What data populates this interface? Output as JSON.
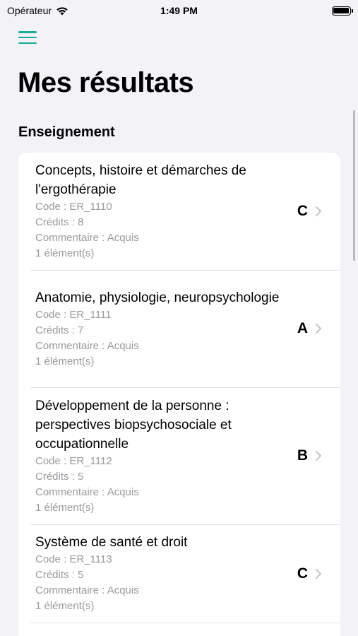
{
  "status_bar": {
    "carrier": "Opérateur",
    "time": "1:49 PM"
  },
  "header": {
    "title": "Mes résultats"
  },
  "section": {
    "title": "Enseignement"
  },
  "courses": [
    {
      "title": "Concepts, histoire et démarches de l'ergothérapie",
      "code": "Code : ER_1110",
      "credits": "Crédits : 8",
      "comment": "Commentaire : Acquis",
      "elements": "1 élément(s)",
      "grade": "C"
    },
    {
      "title": "Anatomie, physiologie, neuropsychologie",
      "code": "Code : ER_1111",
      "credits": "Crédits : 7",
      "comment": "Commentaire : Acquis",
      "elements": "1 élément(s)",
      "grade": "A"
    },
    {
      "title": "Développement de la personne : perspectives biopsychosociale et occupationnelle",
      "code": "Code : ER_1112",
      "credits": "Crédits : 5",
      "comment": "Commentaire : Acquis",
      "elements": "1 élément(s)",
      "grade": "B"
    },
    {
      "title": "Système de santé et droit",
      "code": "Code : ER_1113",
      "credits": "Crédits : 5",
      "comment": "Commentaire : Acquis",
      "elements": "1 élément(s)",
      "grade": "C"
    }
  ],
  "colors": {
    "accent": "#1aab96",
    "background": "#f2f2f7",
    "secondary_text": "#9a9a9f"
  }
}
